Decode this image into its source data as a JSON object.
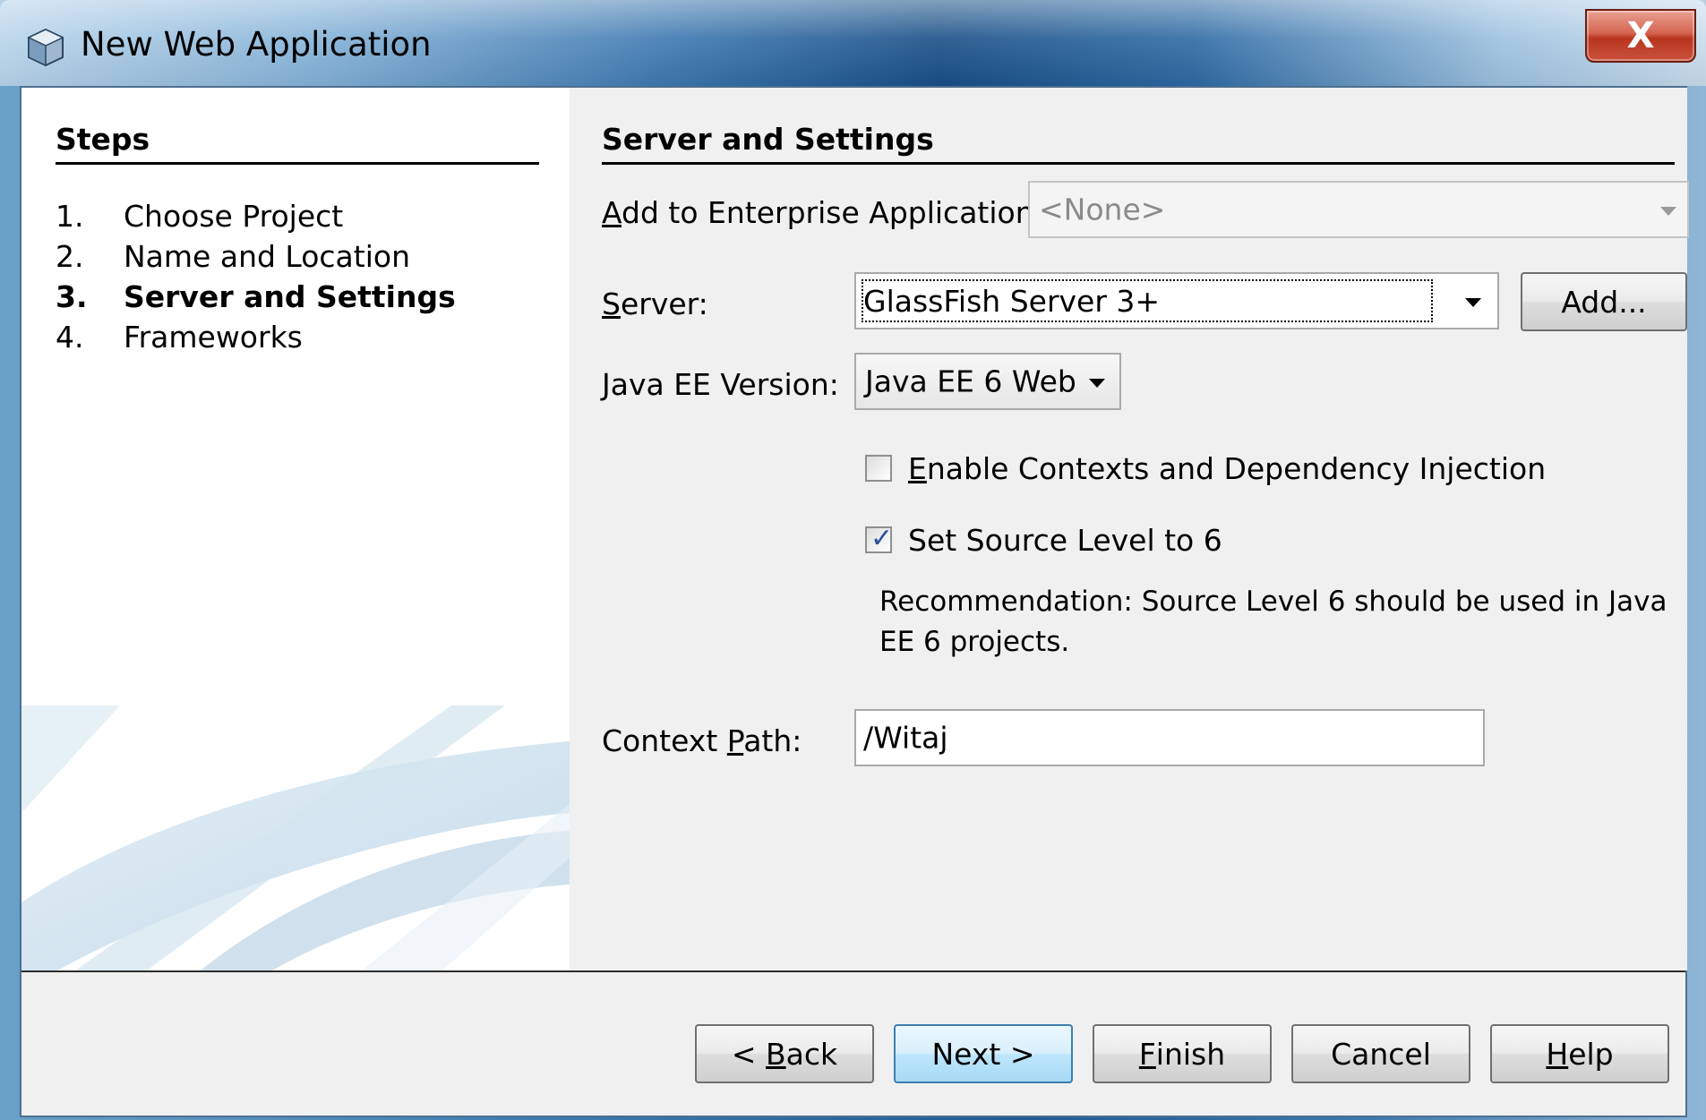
{
  "window": {
    "title": "New Web Application",
    "close_label": "X"
  },
  "steps": {
    "title": "Steps",
    "items": [
      {
        "num": "1.",
        "label": "Choose Project"
      },
      {
        "num": "2.",
        "label": "Name and Location"
      },
      {
        "num": "3.",
        "label": "Server and Settings"
      },
      {
        "num": "4.",
        "label": "Frameworks"
      }
    ],
    "active_index": 2
  },
  "settings": {
    "title": "Server and Settings",
    "enterprise_label_prefix": "",
    "enterprise_label_mnemonic": "A",
    "enterprise_label_rest": "dd to Enterprise Application:",
    "enterprise_value": "<None>",
    "server_label_mnemonic": "S",
    "server_label_rest": "erver:",
    "server_value": "GlassFish Server 3+",
    "add_button": "Add...",
    "javaee_label_mnemonic": "J",
    "javaee_label_rest": "ava EE Version:",
    "javaee_value": "Java EE 6 Web",
    "cdi_label_mnemonic": "E",
    "cdi_label_rest": "nable Contexts and Dependency Injection",
    "cdi_checked": false,
    "source_level_label": "Set Source Level to 6",
    "source_level_checked": true,
    "recommendation": "Recommendation: Source Level 6 should be used in Java EE 6 projects.",
    "context_label_before": "Context ",
    "context_label_mnemonic": "P",
    "context_label_after": "ath:",
    "context_value": "/Witaj"
  },
  "buttons": {
    "back_prefix": "< ",
    "back_mnemonic": "B",
    "back_rest": "ack",
    "next": "Next >",
    "finish_mnemonic": "F",
    "finish_rest": "inish",
    "cancel": "Cancel",
    "help_mnemonic": "H",
    "help_rest": "elp"
  },
  "colors": {
    "title_bar_accent": "#194f86",
    "close_button": "#c9523a",
    "check_color": "#2a4fa0"
  }
}
